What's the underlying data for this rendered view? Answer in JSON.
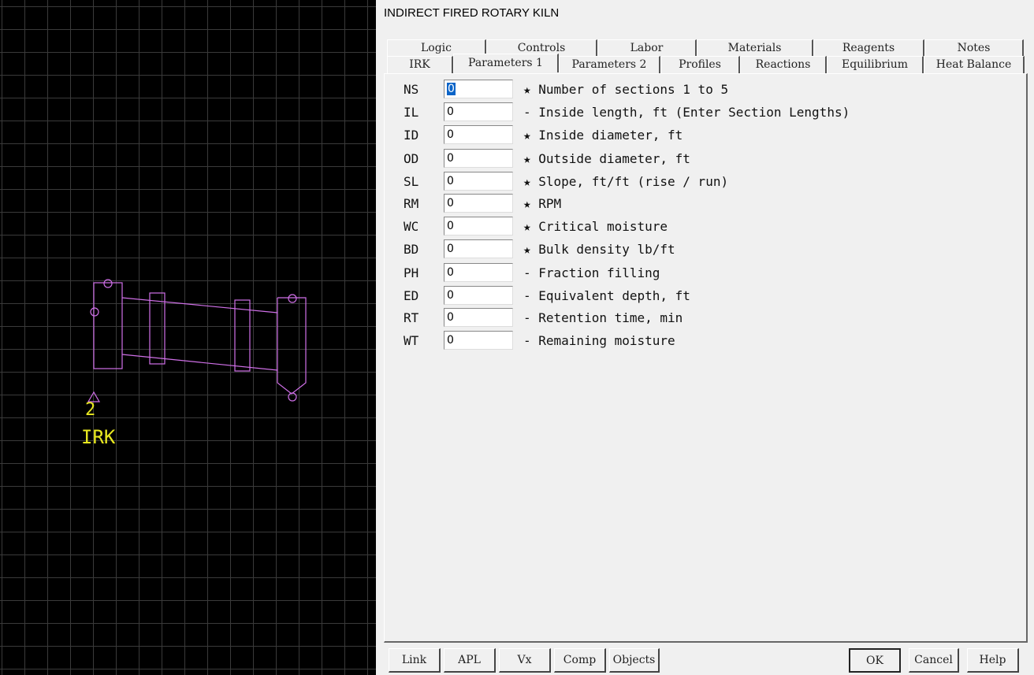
{
  "canvas": {
    "unit_number": "2",
    "unit_tag": "IRK",
    "diagram_color": "#d070e8",
    "label_color": "#e8e820"
  },
  "dialog": {
    "title": "INDIRECT FIRED ROTARY KILN",
    "tabs_back": [
      "Logic",
      "Controls",
      "Labor",
      "Materials",
      "Reagents",
      "Notes"
    ],
    "tabs_front": [
      "IRK",
      "Parameters 1",
      "Parameters 2",
      "Profiles",
      "Reactions",
      "Equilibrium",
      "Heat Balance"
    ],
    "active_tab": "Parameters 1",
    "params": [
      {
        "code": "NS",
        "value": "0",
        "desc": "★ Number of sections 1 to 5"
      },
      {
        "code": "IL",
        "value": "0",
        "desc": "- Inside length, ft (Enter Section Lengths)"
      },
      {
        "code": "ID",
        "value": "0",
        "desc": "★ Inside diameter, ft"
      },
      {
        "code": "OD",
        "value": "0",
        "desc": "★ Outside diameter, ft"
      },
      {
        "code": "SL",
        "value": "0",
        "desc": "★ Slope, ft/ft (rise / run)"
      },
      {
        "code": "RM",
        "value": "0",
        "desc": "★ RPM"
      },
      {
        "code": "WC",
        "value": "0",
        "desc": "★ Critical moisture"
      },
      {
        "code": "BD",
        "value": "0",
        "desc": "★ Bulk density lb/ft"
      },
      {
        "code": "PH",
        "value": "0",
        "desc": "- Fraction filling"
      },
      {
        "code": "ED",
        "value": "0",
        "desc": "- Equivalent depth, ft"
      },
      {
        "code": "RT",
        "value": "0",
        "desc": "- Retention time, min"
      },
      {
        "code": "WT",
        "value": "0",
        "desc": "- Remaining moisture"
      }
    ],
    "buttons_left": [
      "Link",
      "APL",
      "Vx",
      "Comp",
      "Objects"
    ],
    "buttons_right": [
      "OK",
      "Cancel",
      "Help"
    ]
  }
}
